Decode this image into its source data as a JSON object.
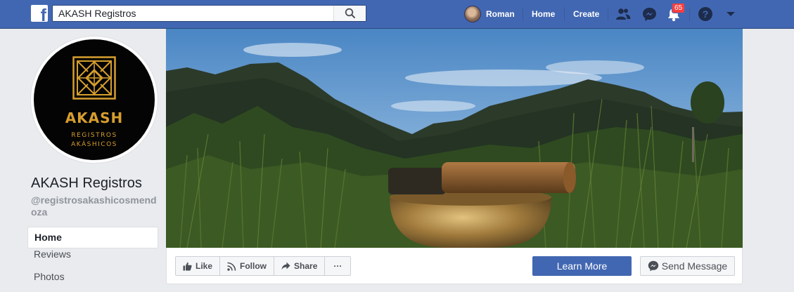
{
  "topbar": {
    "logo_letter": "f",
    "search_value": "AKASH Registros",
    "profile_name": "Roman",
    "home_label": "Home",
    "create_label": "Create",
    "notification_count": "65",
    "icons": [
      "facebook-logo",
      "search-icon",
      "friends-icon",
      "messenger-icon",
      "bell-icon",
      "help-icon",
      "dropdown-arrow-icon"
    ]
  },
  "page": {
    "logo_name": "AKASH",
    "logo_sub_line1": "REGISTROS",
    "logo_sub_line2": "AKÁSHICOS",
    "name": "AKASH Registros",
    "handle": "@registrosakashicosmendoza"
  },
  "side_nav": {
    "items": [
      {
        "label": "Home",
        "active": true
      },
      {
        "label": "Reviews",
        "active": false
      },
      {
        "label": "Photos",
        "active": false
      }
    ]
  },
  "actions": {
    "like_label": "Like",
    "follow_label": "Follow",
    "share_label": "Share",
    "more_label": "···",
    "learn_more_label": "Learn More",
    "send_message_label": "Send Message"
  },
  "colors": {
    "brand_blue": "#4267b2",
    "badge_red": "#fa3e3e",
    "logo_gold": "#d69e2e"
  }
}
